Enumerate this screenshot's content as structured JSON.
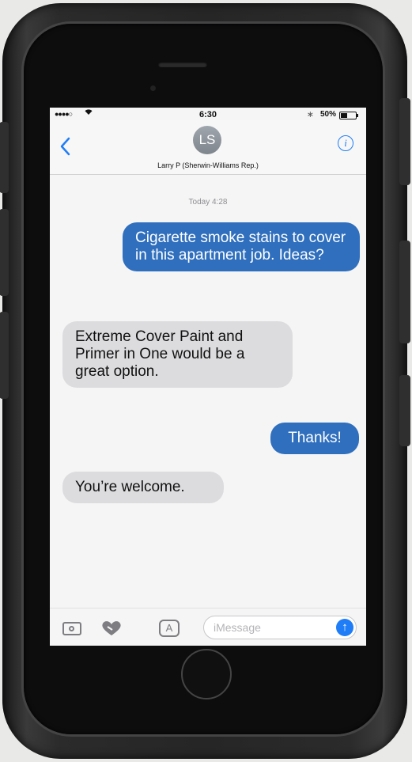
{
  "status_bar": {
    "signal": "●●●●○",
    "wifi_icon": "wifi-icon",
    "time": "6:30",
    "bluetooth": "∗",
    "battery_percent": "50%",
    "battery_level": 0.5
  },
  "header": {
    "back_icon": "chevron-left-icon",
    "avatar_initials": "LS",
    "contact_name": "Larry P (Sherwin-Williams Rep.)",
    "info_icon": "info-icon"
  },
  "conversation": {
    "timestamp": "Today 4:28",
    "messages": [
      {
        "direction": "sent",
        "text": "Cigarette smoke stains to cover in this apartment job. Ideas?"
      },
      {
        "direction": "received",
        "text": "Extreme Cover Paint and Primer in One would be a great option."
      },
      {
        "direction": "sent",
        "text": "Thanks!"
      },
      {
        "direction": "received",
        "text": "You’re welcome."
      }
    ]
  },
  "composer": {
    "camera_icon": "camera-icon",
    "digital_touch_icon": "heart-icon",
    "apps_icon": "app-store-icon",
    "apps_glyph": "A",
    "input_placeholder": "iMessage",
    "send_icon": "arrow-up-icon",
    "send_glyph": "↑"
  },
  "colors": {
    "sent_bubble": "#2f6fbe",
    "received_bubble": "#dcdcdf",
    "accent": "#1f7df7"
  }
}
